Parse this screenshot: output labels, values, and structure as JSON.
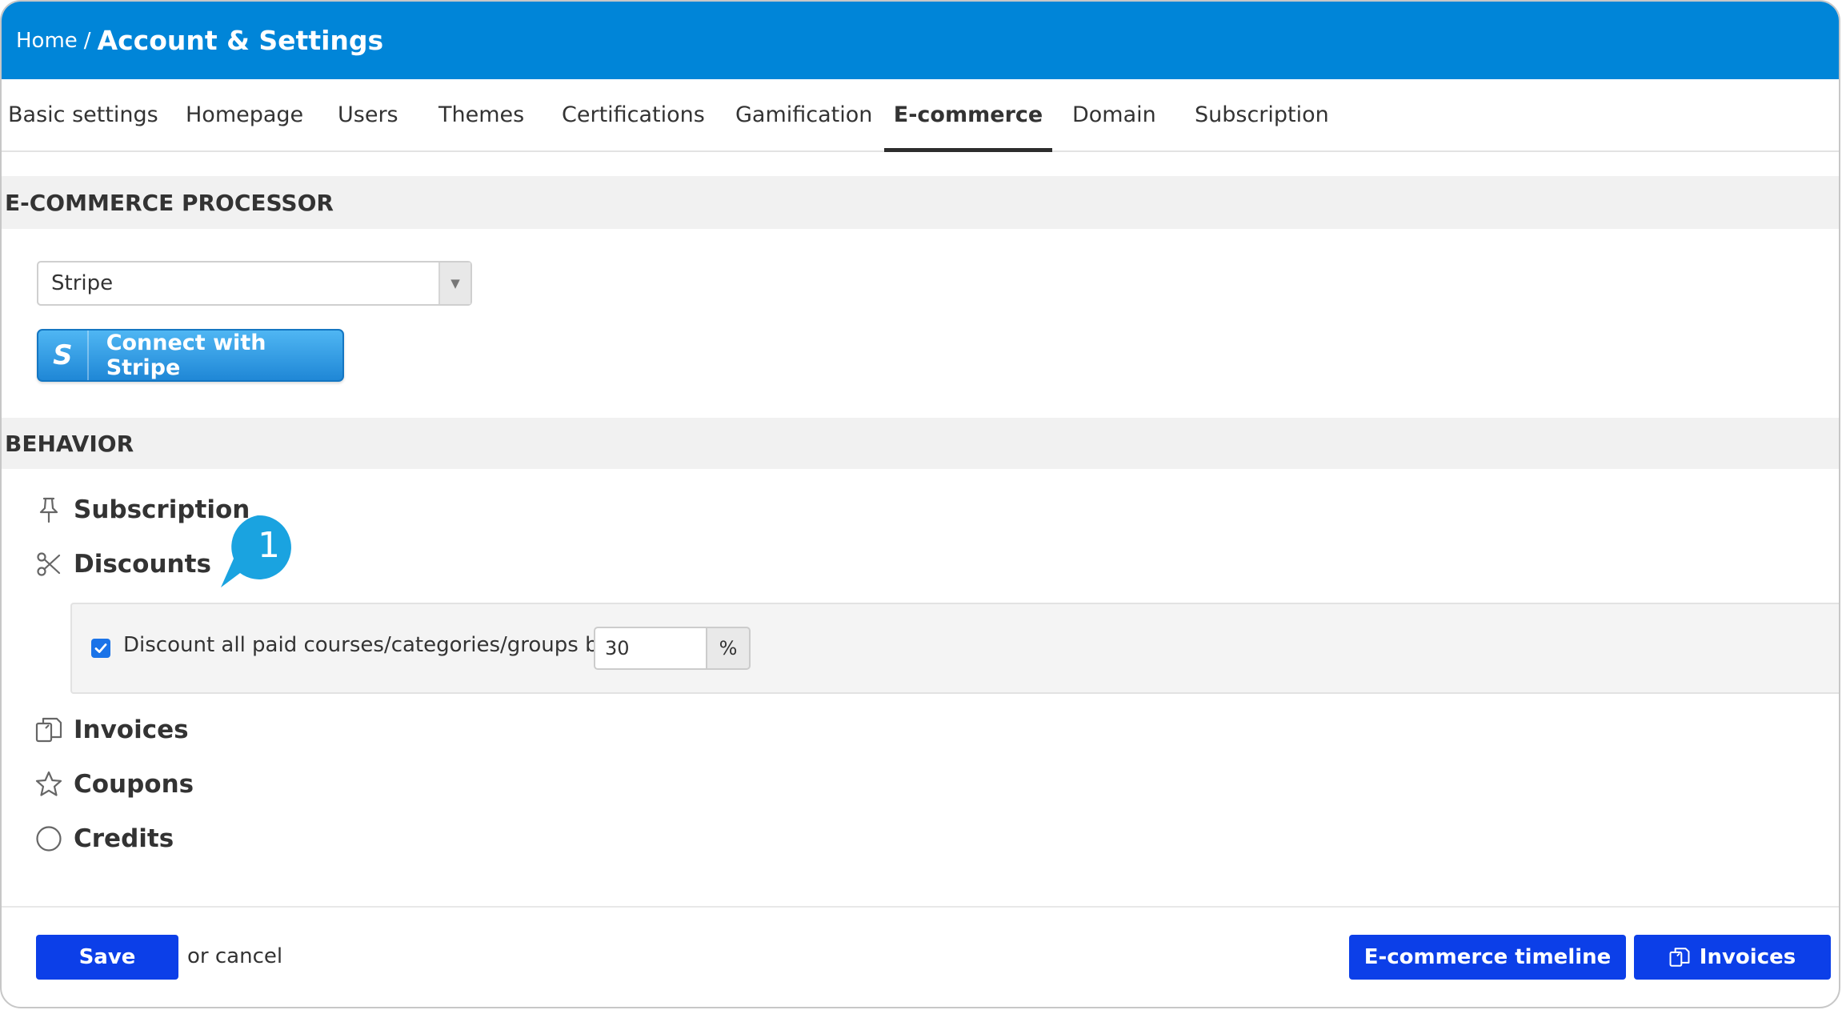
{
  "header": {
    "home": "Home",
    "separator": "/",
    "title": "Account & Settings"
  },
  "tabs": [
    {
      "label": "Basic settings"
    },
    {
      "label": "Homepage"
    },
    {
      "label": "Users"
    },
    {
      "label": "Themes"
    },
    {
      "label": "Certifications"
    },
    {
      "label": "Gamification"
    },
    {
      "label": "E-commerce",
      "active": true
    },
    {
      "label": "Domain"
    },
    {
      "label": "Subscription"
    }
  ],
  "processor": {
    "heading": "E-COMMERCE PROCESSOR",
    "selected": "Stripe",
    "connect_label": "Connect with Stripe",
    "connect_glyph": "S"
  },
  "behavior": {
    "heading": "BEHAVIOR",
    "items": [
      {
        "label": "Subscription",
        "icon": "pin-icon"
      },
      {
        "label": "Discounts",
        "icon": "scissors-icon"
      },
      {
        "label": "Invoices",
        "icon": "invoices-icon"
      },
      {
        "label": "Coupons",
        "icon": "star-icon"
      },
      {
        "label": "Credits",
        "icon": "circle-icon"
      }
    ],
    "discount": {
      "checked": true,
      "label": "Discount all paid courses/categories/groups by",
      "value": "30",
      "unit": "%"
    }
  },
  "callout": {
    "number": "1",
    "color": "#1aa3e0"
  },
  "footer": {
    "save": "Save",
    "or": "or",
    "cancel": "cancel",
    "timeline": "E-commerce timeline",
    "invoices": "Invoices"
  },
  "colors": {
    "header": "#0085d8",
    "primary_button": "#0c3fe8"
  }
}
